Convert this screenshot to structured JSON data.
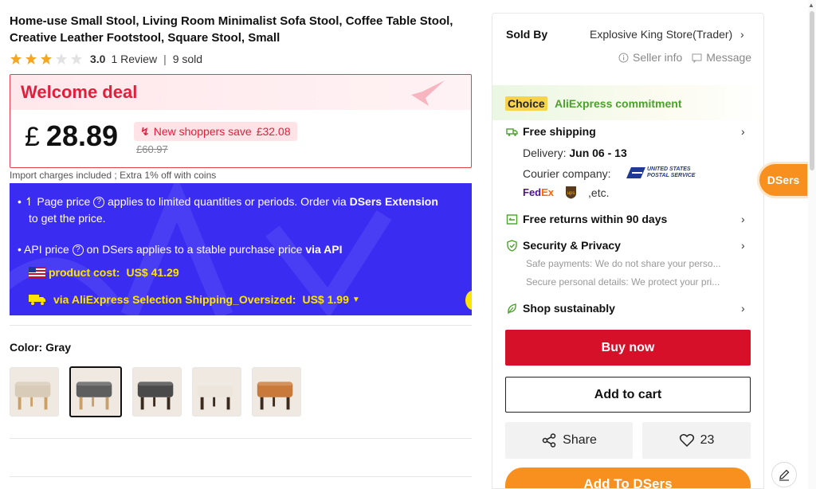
{
  "product": {
    "title": "Home-use Small Stool, Living Room Minimalist Sofa Stool, Coffee Table Stool, Creative Leather Footstool, Square Stool, Small",
    "rating_score": "3.0",
    "rating_value": 3,
    "rating_max": 5,
    "reviews": "1 Review",
    "separator": "|",
    "sold": "9 sold"
  },
  "deal": {
    "title": "Welcome deal",
    "currency": "£",
    "price": "28.89",
    "save_label": "New shoppers save",
    "save_amount": "£32.08",
    "original_price": "£60.97",
    "import_note": "Import charges included ; Extra 1% off with coins"
  },
  "dsers": {
    "line1_pre": "• ↿ Page price",
    "line1_mid": "applies to limited quantities or periods. Order via",
    "line1_bold": "DSers Extension",
    "line1_post": "to get the price.",
    "line2_pre": "• API price",
    "line2_mid": "on DSers applies to a stable purchase price",
    "line2_bold": "via API",
    "help_glyph": "?",
    "cost_label": "product cost:",
    "cost_value": "US$ 41.29",
    "ship_label": "via AliExpress Selection Shipping_Oversized:",
    "ship_value": "US$ 1.99"
  },
  "color": {
    "label": "Color: Gray",
    "selected_index": 1,
    "swatches": [
      {
        "name": "beige",
        "cushion": "#d8cbb8",
        "legs": "#c9a06a"
      },
      {
        "name": "gray",
        "cushion": "#5e5e5e",
        "legs": "#c9a06a"
      },
      {
        "name": "dark-gray",
        "cushion": "#4a4a4a",
        "legs": "#3b2a1e"
      },
      {
        "name": "cream",
        "cushion": "#ece6dc",
        "legs": "#3b2a1e"
      },
      {
        "name": "orange",
        "cushion": "#c97a3a",
        "legs": "#3b2a1e"
      }
    ]
  },
  "seller": {
    "sold_by_label": "Sold By",
    "store_name": "Explosive King Store(Trader)",
    "seller_info": "Seller info",
    "message": "Message"
  },
  "commitment": {
    "badge": "Choice",
    "title": "AliExpress commitment",
    "free_shipping": "Free shipping",
    "delivery_label": "Delivery:",
    "delivery_dates": "Jun 06 - 13",
    "courier_label": "Courier company:",
    "usps_line1": "UNITED STATES",
    "usps_line2": "POSTAL SERVICE",
    "fedex_fe": "Fed",
    "fedex_ex": "Ex",
    "ups": "ups",
    "etc": ",etc.",
    "returns": "Free returns within 90 days",
    "security": "Security & Privacy",
    "security_line1": "Safe payments: We do not share your perso...",
    "security_line2": "Secure personal details: We protect your pri...",
    "sustainable": "Shop sustainably"
  },
  "actions": {
    "buy_now": "Buy now",
    "add_to_cart": "Add to cart",
    "share": "Share",
    "wishlist_count": "23",
    "add_to_dsers": "Add To DSers",
    "dsers_tab": "DSers"
  },
  "icons": [
    "star-icon",
    "help-icon",
    "us-flag-icon",
    "truck-icon",
    "chevron-right-icon",
    "info-icon",
    "message-icon",
    "shipping-icon",
    "return-icon",
    "shield-icon",
    "leaf-icon",
    "share-icon",
    "heart-icon",
    "edit-icon",
    "caret-down-icon"
  ],
  "colors": {
    "accent_red": "#d7102a",
    "dsers_blue": "#3a2cf0",
    "dsers_orange": "#f7901e",
    "choice_green": "#4aa22a",
    "highlight_yellow": "#ffe400"
  }
}
